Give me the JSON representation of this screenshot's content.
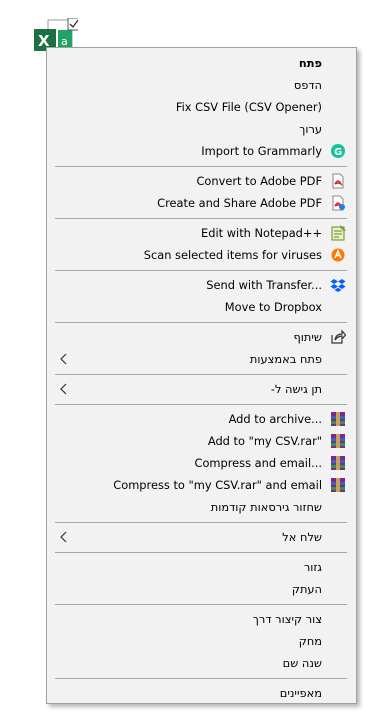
{
  "menu": {
    "items": [
      {
        "label": "פתח"
      },
      {
        "label": "הדפס"
      },
      {
        "label": "Fix CSV File (CSV Opener)"
      },
      {
        "label": "ערוך"
      },
      {
        "label": "Import to Grammarly"
      },
      {
        "label": "Convert to Adobe PDF"
      },
      {
        "label": "Create and Share Adobe PDF"
      },
      {
        "label": "Edit with Notepad++"
      },
      {
        "label": "Scan selected items for viruses"
      },
      {
        "label": "Send with Transfer..."
      },
      {
        "label": "Move to Dropbox"
      },
      {
        "label": "שיתוף"
      },
      {
        "label": "פתח באמצעות"
      },
      {
        "label": "תן גישה ל-"
      },
      {
        "label": "Add to archive..."
      },
      {
        "label": "Add to \"my CSV.rar\""
      },
      {
        "label": "Compress and email..."
      },
      {
        "label": "Compress to \"my CSV.rar\" and email"
      },
      {
        "label": "שחזור גירסאות קודמות"
      },
      {
        "label": "שלח אל"
      },
      {
        "label": "גזור"
      },
      {
        "label": "העתק"
      },
      {
        "label": "צור קיצור דרך"
      },
      {
        "label": "מחק"
      },
      {
        "label": "שנה שם"
      },
      {
        "label": "מאפיינים"
      }
    ]
  },
  "colors": {
    "menu_background": "#f2f2f2",
    "separator": "#a6a6a6",
    "excel_green": "#1d7044",
    "grammarly_green": "#15c39a",
    "dropbox_blue": "#0061fe",
    "adobe_red": "#d5242a"
  }
}
